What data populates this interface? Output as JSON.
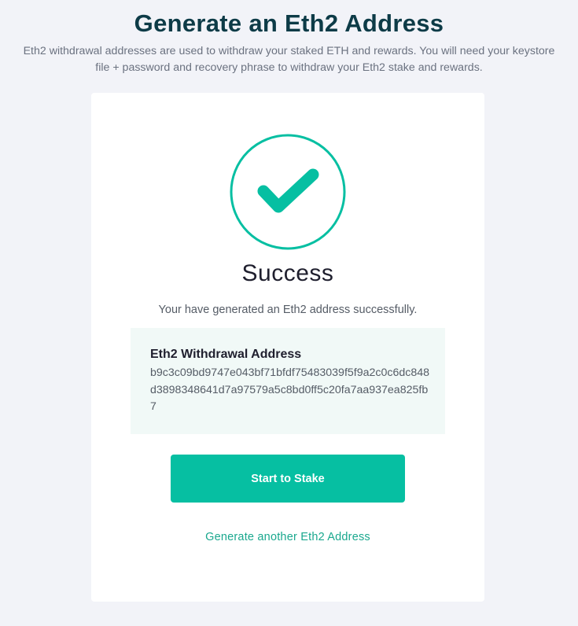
{
  "header": {
    "title": "Generate an Eth2 Address",
    "subtitle": "Eth2 withdrawal addresses are used to withdraw your staked ETH and rewards. You will need your keystore file + password and recovery phrase to withdraw your Eth2 stake and rewards."
  },
  "card": {
    "icon": "checkmark-circle-icon",
    "heading": "Success",
    "message": "Your have generated an Eth2 address successfully.",
    "address": {
      "label": "Eth2 Withdrawal Address",
      "value": "b9c3c09bd9747e043bf71bfdf75483039f5f9a2c0c6dc848d3898348641d7a97579a5c8bd0ff5c20fa7aa937ea825fb7"
    },
    "stake_button_label": "Start to Stake",
    "generate_another_label": "Generate another Eth2 Address"
  },
  "colors": {
    "accent": "#06bfa2",
    "background": "#f2f3f8",
    "title": "#0d3b47"
  }
}
